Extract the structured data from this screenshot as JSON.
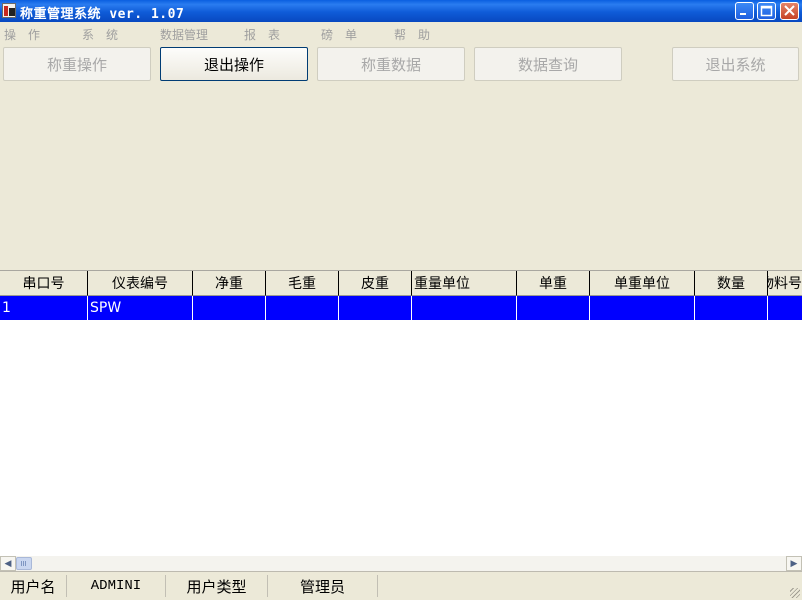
{
  "window": {
    "title": "称重管理系统 ver. 1.07"
  },
  "menu": [
    "操　作",
    "系　统",
    "数据管理",
    "报　表",
    "磅　单",
    "帮　助"
  ],
  "toolbar": [
    "称重操作",
    "退出操作",
    "称重数据",
    "数据查询",
    "退出系统"
  ],
  "grid": {
    "columns": [
      "串口号",
      "仪表编号",
      "净重",
      "毛重",
      "皮重",
      "重量单位",
      "单重",
      "单重单位",
      "数量",
      "物料号"
    ],
    "rows": [
      [
        "1",
        "SPW",
        "",
        "",
        "",
        "",
        "",
        "",
        "",
        ""
      ]
    ]
  },
  "status": {
    "user_label": "用户名",
    "user_value": "ADMINI",
    "type_label": "用户类型",
    "type_value": "管理员"
  },
  "colors": {
    "title_bar": "#0A5FE0",
    "selection": "#0000FF",
    "face": "#ECE9D8"
  },
  "icons": {
    "app": "app-icon",
    "minimize": "minimize-icon",
    "maximize": "maximize-icon",
    "close": "close-icon"
  }
}
